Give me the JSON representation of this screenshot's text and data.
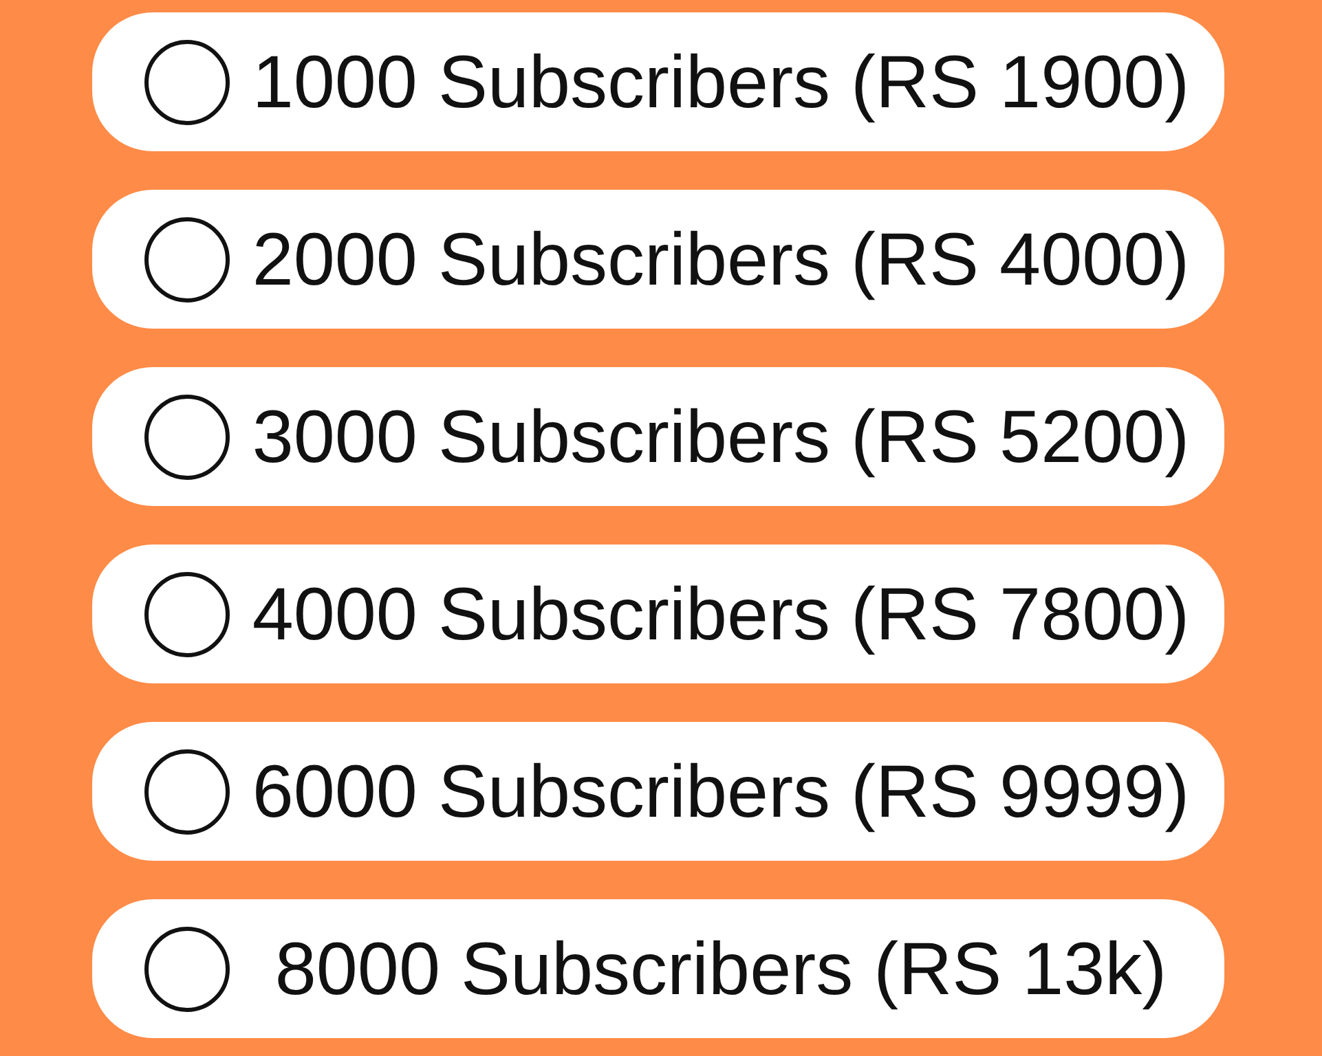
{
  "options": [
    {
      "label": "1000 Subscribers (RS 1900)",
      "selected": false
    },
    {
      "label": "2000 Subscribers (RS 4000)",
      "selected": false
    },
    {
      "label": "3000 Subscribers (RS 5200)",
      "selected": false
    },
    {
      "label": "4000 Subscribers (RS 7800)",
      "selected": false
    },
    {
      "label": "6000 Subscribers (RS 9999)",
      "selected": false
    },
    {
      "label": "8000 Subscribers (RS 13k)",
      "selected": false
    }
  ]
}
